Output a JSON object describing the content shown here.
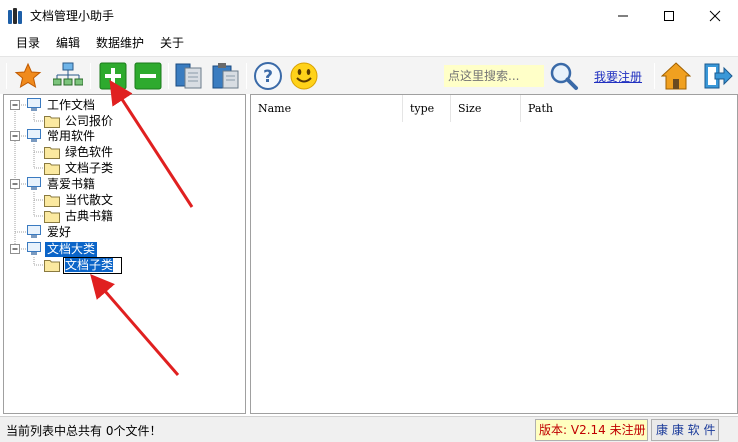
{
  "window": {
    "title": "文档管理小助手"
  },
  "menu": [
    "目录",
    "编辑",
    "数据维护",
    "关于"
  ],
  "toolbar": {
    "search_placeholder": "点这里搜索...",
    "register_label": "我要注册"
  },
  "tree": {
    "nodes": [
      {
        "label": "工作文档",
        "level": 0
      },
      {
        "label": "公司报价",
        "level": 1
      },
      {
        "label": "常用软件",
        "level": 0
      },
      {
        "label": "绿色软件",
        "level": 1
      },
      {
        "label": "文档子类",
        "level": 1
      },
      {
        "label": "喜爱书籍",
        "level": 0
      },
      {
        "label": "当代散文",
        "level": 1
      },
      {
        "label": "古典书籍",
        "level": 1
      },
      {
        "label": "爱好",
        "level": 0
      },
      {
        "label": "文档大类",
        "level": 0,
        "selected": true
      },
      {
        "label": "文档子类",
        "level": 1,
        "editing": true
      }
    ]
  },
  "list": {
    "columns": [
      "Name",
      "type",
      "Size",
      "Path"
    ]
  },
  "statusbar": {
    "text": "当前列表中总共有 0个文件！",
    "version": "版本: V2.14 未注册",
    "brand": "康 康 软 件"
  },
  "colors": {
    "accent_blue": "#0a64c8",
    "arrow_red": "#e02020",
    "add_green": "#2eaa2e"
  },
  "icons": [
    "star-icon",
    "network-icon",
    "add-icon",
    "remove-icon",
    "copy-icon",
    "paste-icon",
    "help-icon",
    "smiley-icon",
    "search-icon",
    "home-icon",
    "exit-icon"
  ]
}
